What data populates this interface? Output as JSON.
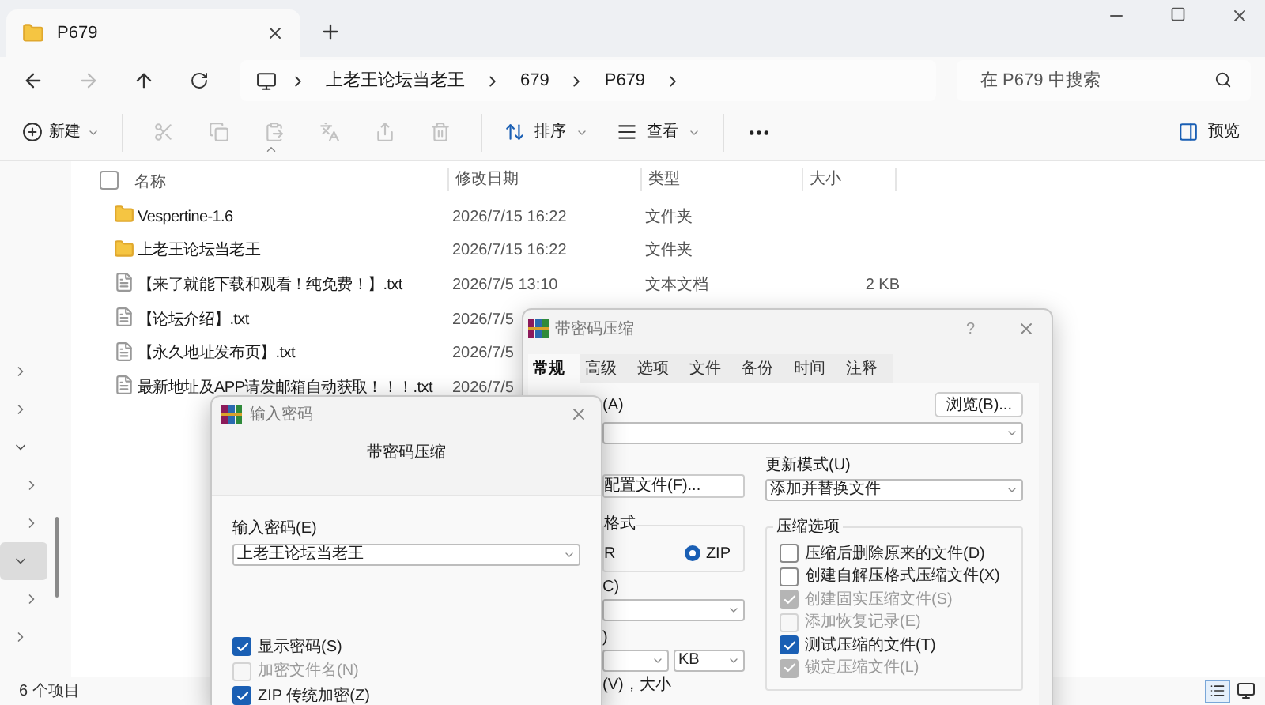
{
  "tab": {
    "title": "P679"
  },
  "address": {
    "segments": [
      "上老王论坛当老王",
      "679",
      "P679"
    ]
  },
  "search": {
    "placeholder": "在 P679 中搜索"
  },
  "toolbar": {
    "new": "新建",
    "sort": "排序",
    "view": "查看",
    "preview": "预览"
  },
  "sidebar": {
    "items": [
      {
        "expanded": false,
        "selected": false
      },
      {
        "expanded": false,
        "selected": false
      },
      {
        "expanded": true,
        "selected": false,
        "children": [
          {
            "expanded": false,
            "selected": false
          },
          {
            "expanded": false,
            "selected": false
          }
        ]
      },
      {
        "expanded": true,
        "selected": true,
        "children": [
          {
            "expanded": false,
            "selected": false
          }
        ]
      },
      {
        "expanded": false,
        "selected": false
      }
    ]
  },
  "select_all": {
    "checked": false
  },
  "columns": [
    "名称",
    "修改日期",
    "类型",
    "大小"
  ],
  "files": [
    {
      "kind": "folder",
      "name": "Vespertine-1.6",
      "date": "2026/7/15 16:22",
      "type": "文件夹"
    },
    {
      "kind": "folder",
      "name": "上老王论坛当老王",
      "date": "2026/7/15 16:22",
      "type": "文件夹"
    },
    {
      "kind": "file",
      "name": "【来了就能下载和观看！纯免费！】.txt",
      "date": "2026/7/5 13:10",
      "type": "文本文档",
      "size": "2 KB"
    },
    {
      "kind": "file",
      "name": "【论坛介绍】.txt",
      "date": "2026/7/5"
    },
    {
      "kind": "file",
      "name": "【永久地址发布页】.txt",
      "date": "2026/7/5"
    },
    {
      "kind": "file",
      "name": "最新地址及APP请发邮箱自动获取！！！.txt",
      "date": "2026/7/5"
    }
  ],
  "status": "6 个项目",
  "rar": {
    "title": "带密码压缩",
    "help": "?",
    "tabs": [
      {
        "label": "常规",
        "selected": true
      },
      {
        "label": "高级",
        "selected": false
      },
      {
        "label": "选项",
        "selected": false
      },
      {
        "label": "文件",
        "selected": false
      },
      {
        "label": "备份",
        "selected": false
      },
      {
        "label": "时间",
        "selected": false
      },
      {
        "label": "注释",
        "selected": false
      }
    ],
    "archive_label": "(A)",
    "browse": "浏览(B)...",
    "profiles": "配置文件(F)...",
    "update_label": "更新模式(U)",
    "update_value": "添加并替换文件",
    "format": {
      "title": "格式",
      "fragment": "R",
      "zip": {
        "label": "ZIP",
        "selected": true
      }
    },
    "method_label": "C)",
    "split_label": ")",
    "split_unit": "KB",
    "volume_label": "(V)，大小",
    "options_title": "压缩选项",
    "options": [
      {
        "label": "压缩后删除原来的文件(D)",
        "checked": false,
        "disabled": false
      },
      {
        "label": "创建自解压格式压缩文件(X)",
        "checked": false,
        "disabled": false
      },
      {
        "label": "创建固实压缩文件(S)",
        "checked": true,
        "disabled": true
      },
      {
        "label": "添加恢复记录(E)",
        "checked": false,
        "disabled": true
      },
      {
        "label": "测试压缩的文件(T)",
        "checked": true,
        "disabled": false
      },
      {
        "label": "锁定压缩文件(L)",
        "checked": true,
        "disabled": true
      }
    ]
  },
  "password": {
    "title": "输入密码",
    "heading": "带密码压缩",
    "field_label": "输入密码(E)",
    "value": "上老王论坛当老王",
    "options": [
      {
        "label": "显示密码(S)",
        "checked": true,
        "disabled": false
      },
      {
        "label": "加密文件名(N)",
        "checked": false,
        "disabled": true
      },
      {
        "label": "ZIP 传统加密(Z)",
        "checked": true,
        "disabled": false
      }
    ]
  }
}
